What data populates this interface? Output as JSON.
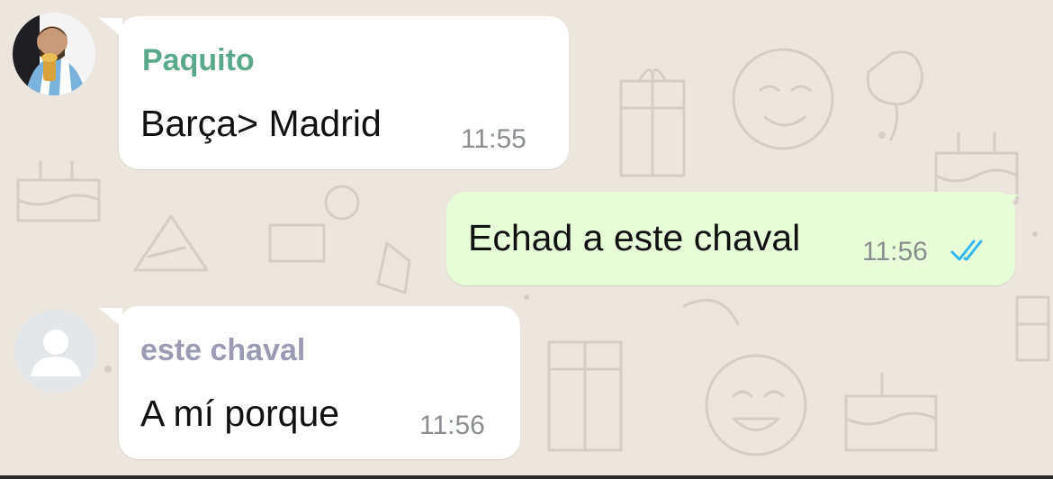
{
  "colors": {
    "background": "#ECE6DE",
    "incoming_bubble": "#FFFFFF",
    "outgoing_bubble": "#E7FDD8",
    "read_ticks": "#34B7F1"
  },
  "messages": [
    {
      "direction": "incoming",
      "sender": "Paquito",
      "sender_color": "#5BA98B",
      "avatar": "user-photo-avatar",
      "text": "Barça> Madrid",
      "time": "11:55"
    },
    {
      "direction": "outgoing",
      "text": "Echad a este chaval",
      "time": "11:56",
      "status_icon": "double-check-read-icon"
    },
    {
      "direction": "incoming",
      "sender": "este chaval",
      "sender_color": "#9C9BB4",
      "avatar": "default-user-avatar",
      "text": "A mí porque",
      "time": "11:56"
    }
  ]
}
